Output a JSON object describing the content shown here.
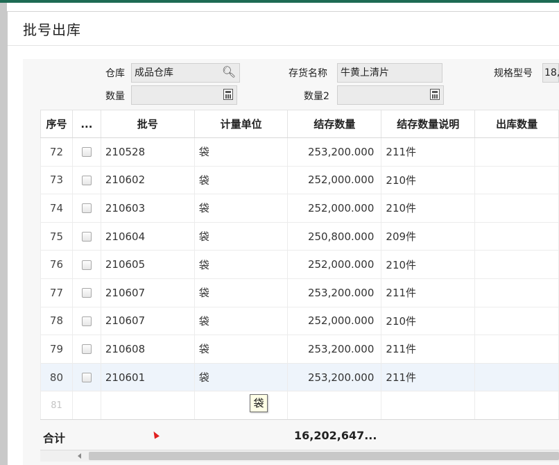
{
  "dialog": {
    "title": "批号出库"
  },
  "form": {
    "warehouse": {
      "label": "仓库",
      "value": "成品仓库"
    },
    "item_name": {
      "label": "存货名称",
      "value": "牛黄上清片"
    },
    "spec": {
      "label": "规格型号",
      "value": "18,"
    },
    "quantity": {
      "label": "数量",
      "value": ""
    },
    "quantity2": {
      "label": "数量2",
      "value": ""
    }
  },
  "icons": {
    "lookup": "search-icon",
    "calculator": "calculator-icon"
  },
  "grid": {
    "columns": [
      "序号",
      "...",
      "批号",
      "计量单位",
      "结存数量",
      "结存数量说明",
      "出库数量"
    ],
    "rows": [
      {
        "seq": "72",
        "batch": "210528",
        "unit": "袋",
        "stock": "253,200.000",
        "desc": "211件",
        "out": ""
      },
      {
        "seq": "73",
        "batch": "210602",
        "unit": "袋",
        "stock": "252,000.000",
        "desc": "210件",
        "out": ""
      },
      {
        "seq": "74",
        "batch": "210603",
        "unit": "袋",
        "stock": "252,000.000",
        "desc": "210件",
        "out": ""
      },
      {
        "seq": "75",
        "batch": "210604",
        "unit": "袋",
        "stock": "250,800.000",
        "desc": "209件",
        "out": ""
      },
      {
        "seq": "76",
        "batch": "210605",
        "unit": "袋",
        "stock": "252,000.000",
        "desc": "210件",
        "out": ""
      },
      {
        "seq": "77",
        "batch": "210607",
        "unit": "袋",
        "stock": "253,200.000",
        "desc": "211件",
        "out": ""
      },
      {
        "seq": "78",
        "batch": "210607",
        "unit": "袋",
        "stock": "252,000.000",
        "desc": "210件",
        "out": ""
      },
      {
        "seq": "79",
        "batch": "210608",
        "unit": "袋",
        "stock": "253,200.000",
        "desc": "211件",
        "out": ""
      },
      {
        "seq": "80",
        "batch": "210601",
        "unit": "袋",
        "stock": "253,200.000",
        "desc": "211件",
        "out": ""
      }
    ],
    "empty_row_seq": "81",
    "total": {
      "label": "合计",
      "value": "16,202,647..."
    }
  },
  "tooltip": {
    "text": "袋"
  }
}
